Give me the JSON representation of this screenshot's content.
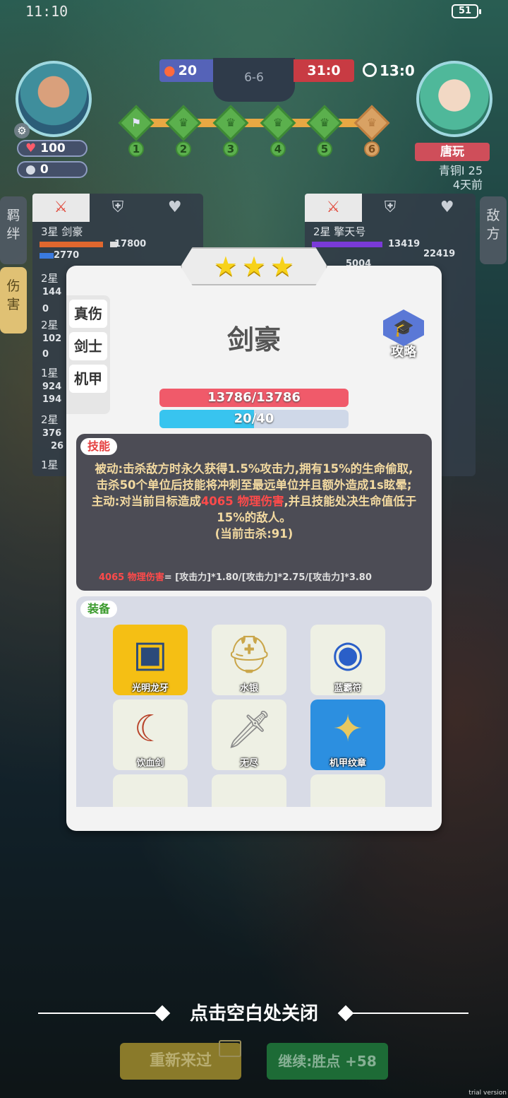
{
  "status_bar": {
    "time": "11:10",
    "battery": "51"
  },
  "hud": {
    "player_hp": "100",
    "player_coins": "0",
    "blue_score": "20",
    "round": "6-6",
    "red_score": "31:0",
    "timer": "13:0",
    "stages": [
      "1",
      "2",
      "3",
      "4",
      "5",
      "6"
    ],
    "opponent_name": "唐玩",
    "opponent_rank": "青铜I 25",
    "opponent_days": "4天前"
  },
  "side_tabs": {
    "bonds": "羁\n绊",
    "damage": "伤\n害",
    "enemy": "敌\n方"
  },
  "left_panel": {
    "units": [
      {
        "label": "3星 剑豪",
        "v1": "17800",
        "v2": "2770"
      },
      {
        "label": "2星",
        "v1": "144",
        "v2": "0"
      },
      {
        "label": "2星",
        "v1": "102",
        "v2": "0"
      },
      {
        "label": "1星",
        "v1": "924",
        "v2": "194"
      },
      {
        "label": "2星",
        "v1": "376",
        "v2": "26"
      },
      {
        "label": "1星",
        "v1": "",
        "v2": ""
      }
    ]
  },
  "right_panel": {
    "units": [
      {
        "label": "2星 擎天号",
        "v1": "13419",
        "v2": "22419",
        "v3": "5004"
      }
    ]
  },
  "modal": {
    "stars": 3,
    "traits": [
      "真伤",
      "剑士",
      "机甲"
    ],
    "hero_name": "剑豪",
    "guide_label": "攻略",
    "hp_text": "13786/13786",
    "mana_text": "20/40",
    "mana_fraction": 0.5,
    "skill": {
      "section_label": "技能",
      "passive": "被动:击杀敌方时永久获得1.5%攻击力,拥有15%的生命偷取,击杀50个单位后技能将冲刺至最远单位并且额外造成1s眩晕;",
      "active_prefix": "主动:对当前目标造成",
      "active_damage": "4065 物理伤害",
      "active_suffix": ",并且技能处决生命值低于15%的敌人。",
      "kills": "(当前击杀:91)",
      "formula_red": "4065 物理伤害",
      "formula_rest": "= [攻击力]*1.80/[攻击力]*2.75/[攻击力]*3.80"
    },
    "equipment": {
      "section_label": "装备",
      "items": [
        {
          "name": "光明龙牙",
          "icon": "armor-icon",
          "bg": "yellow"
        },
        {
          "name": "水银",
          "icon": "helmet-icon",
          "bg": "white"
        },
        {
          "name": "蓝霸符",
          "icon": "orb-icon",
          "bg": "white"
        },
        {
          "name": "饮血剑",
          "icon": "scythe-icon",
          "bg": "white"
        },
        {
          "name": "无尽",
          "icon": "sword-icon",
          "bg": "white"
        },
        {
          "name": "机甲纹章",
          "icon": "emblem-icon",
          "bg": "blue"
        }
      ]
    }
  },
  "bottom": {
    "close_hint": "点击空白处关闭",
    "retry": "重新来过",
    "continue": "继续:胜点 +58",
    "watermark": "trial version"
  }
}
